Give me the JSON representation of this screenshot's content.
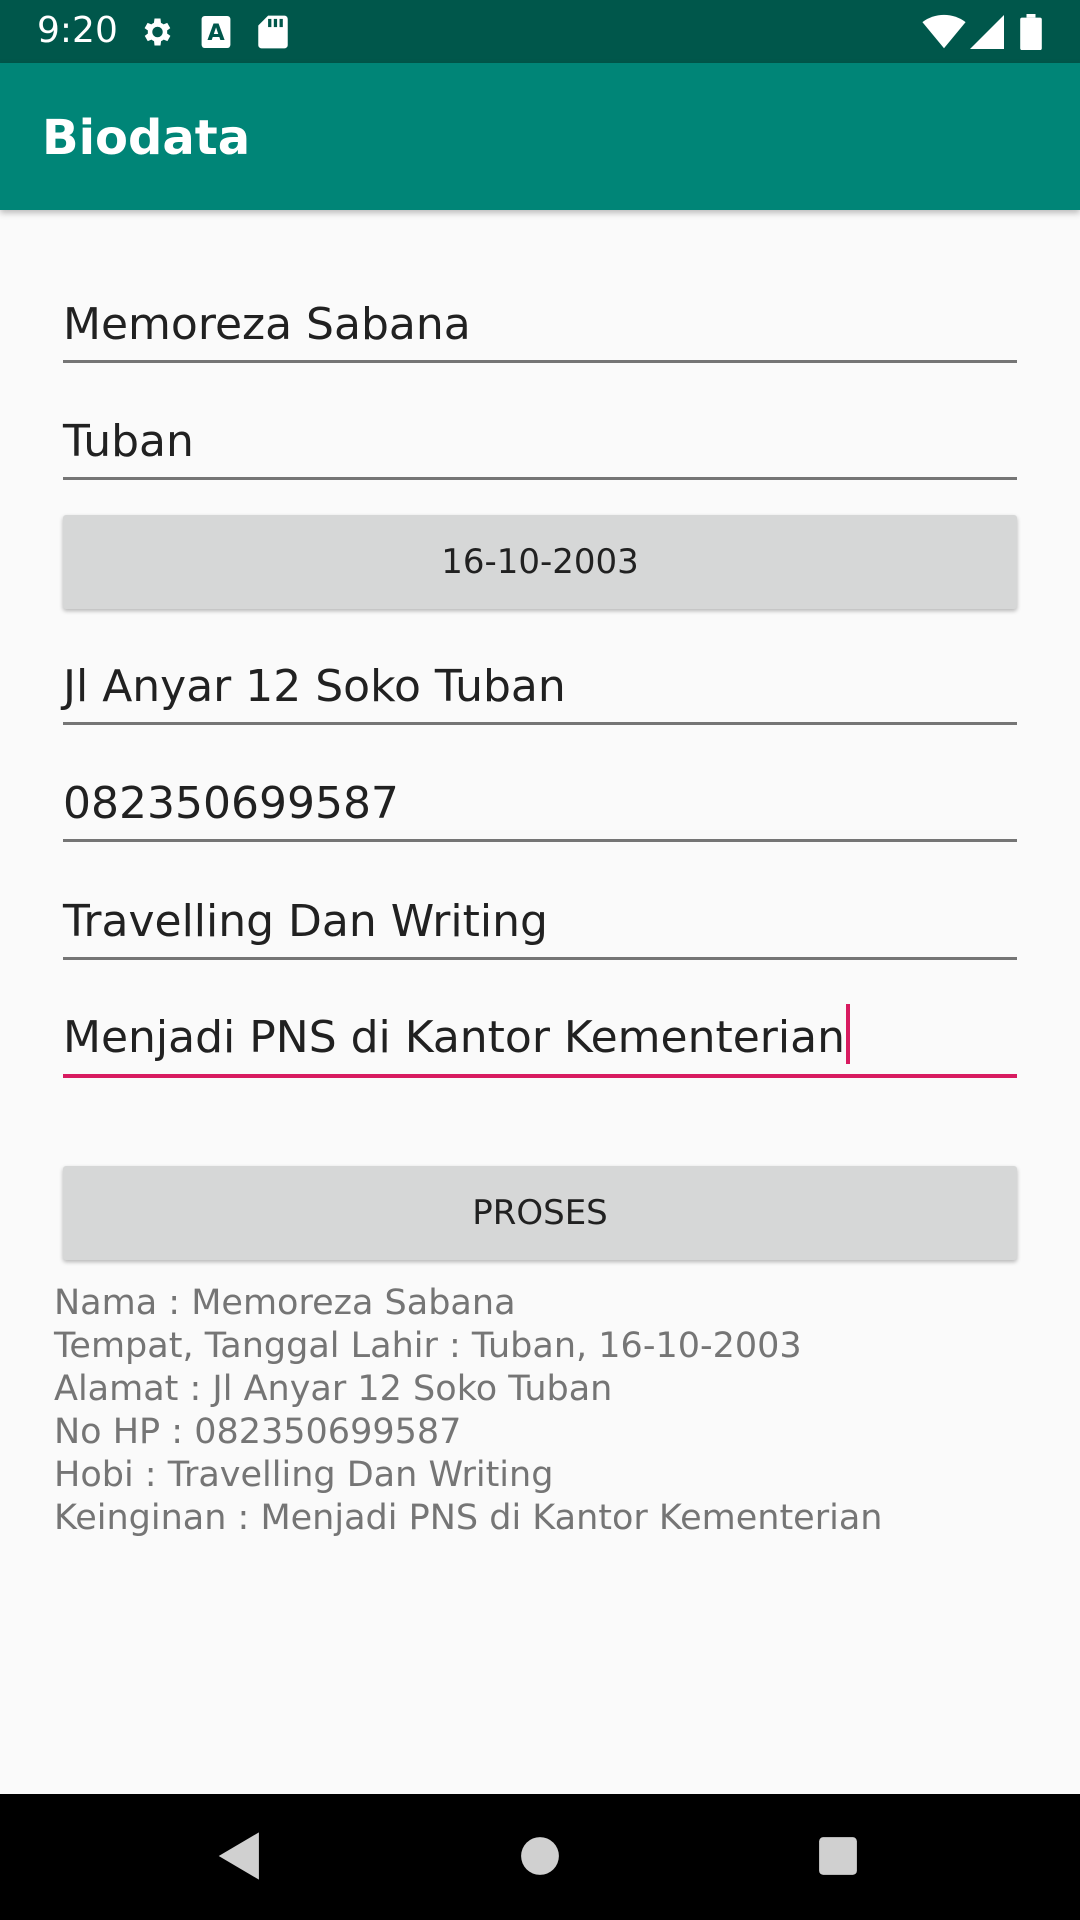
{
  "status_bar": {
    "time": "9:20",
    "icons": [
      "settings-icon",
      "text-a-icon",
      "sd-card-icon",
      "wifi-icon",
      "signal-icon",
      "battery-icon"
    ]
  },
  "app_bar": {
    "title": "Biodata"
  },
  "form": {
    "nama": "Memoreza Sabana",
    "tempat": "Tuban",
    "tanggal_button": "16-10-2003",
    "alamat": "Jl Anyar 12 Soko Tuban",
    "no_hp": "082350699587",
    "hobi": "Travelling Dan Writing",
    "keinginan": "Menjadi PNS di Kantor Kementerian"
  },
  "proses_button": "PROSES",
  "result_lines": [
    "Nama : Memoreza Sabana",
    "Tempat, Tanggal Lahir : Tuban, 16-10-2003",
    "Alamat : Jl Anyar 12 Soko Tuban",
    "No HP : 082350699587",
    "Hobi : Travelling Dan Writing",
    "Keinginan : Menjadi PNS di Kantor Kementerian"
  ],
  "nav_bar": {
    "icons": [
      "back-icon",
      "home-icon",
      "recents-icon"
    ]
  },
  "colors": {
    "status_bar": "#00574b",
    "app_bar": "#008577",
    "accent": "#d81b60",
    "button": "#d6d7d7",
    "background": "#fafafa"
  }
}
